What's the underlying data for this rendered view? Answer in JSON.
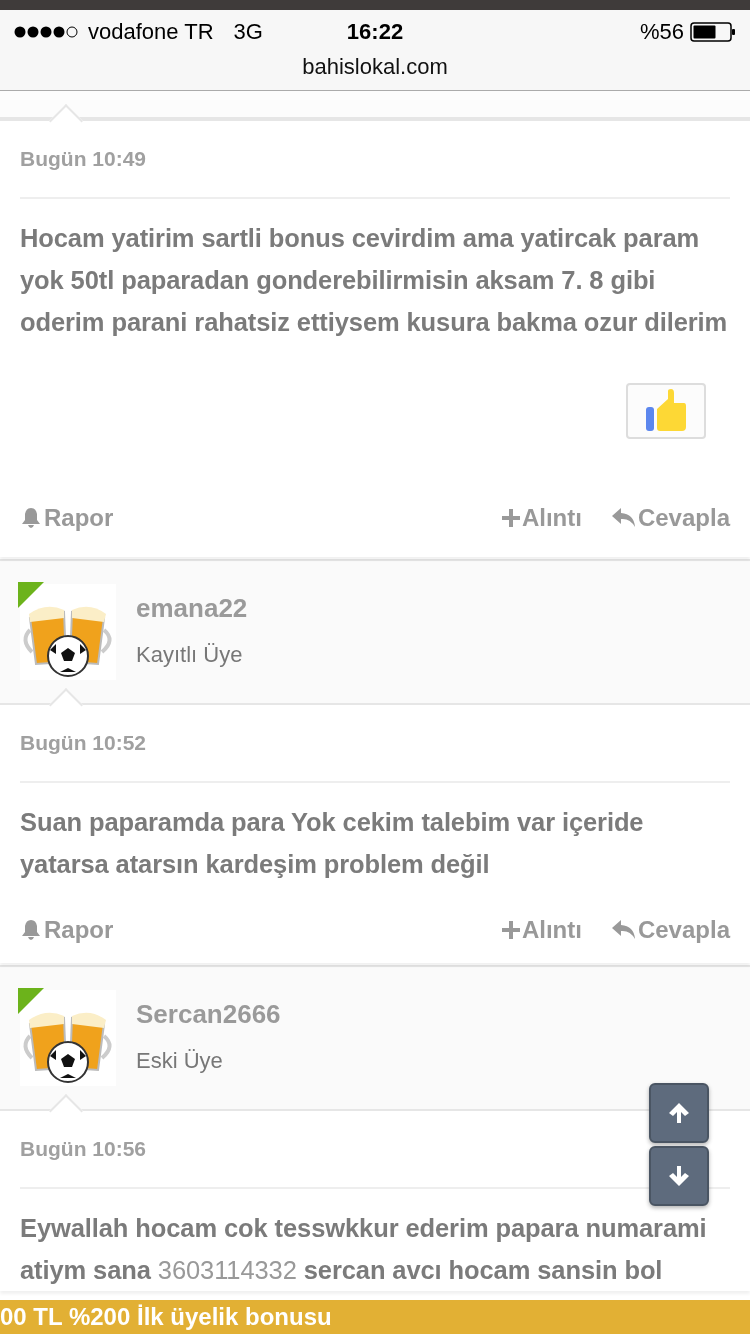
{
  "status_bar": {
    "carrier": "vodafone TR",
    "network": "3G",
    "time": "16:22",
    "battery": "%56"
  },
  "address_bar": {
    "url": "bahislokal.com"
  },
  "posts": [
    {
      "date": "Bugün 10:49",
      "message": [
        {
          "kind": "plain",
          "text": "Hocam yatirim sartli bonus cevirdim ama yatircak param yok 50tl paparadan gonderebilirmisin aksam 7. 8 gibi oderim parani rahatsiz ettiysem kusura bakma ozur dilerim"
        }
      ],
      "liked": true,
      "actions": {
        "report": "Rapor",
        "quote": "Alıntı",
        "reply": "Cevapla"
      }
    },
    {
      "user": {
        "name": "emana22",
        "role": "Kayıtlı Üye",
        "online": true
      },
      "date": "Bugün 10:52",
      "message": [
        {
          "kind": "plain",
          "text": "Suan paparamda para Yok cekim talebim var içeride yatarsa atarsın kardeşim problem değil"
        }
      ],
      "actions": {
        "report": "Rapor",
        "quote": "Alıntı",
        "reply": "Cevapla"
      }
    },
    {
      "user": {
        "name": "Sercan2666",
        "role": "Eski Üye",
        "online": true
      },
      "date": "Bugün 10:56",
      "message": [
        {
          "kind": "plain",
          "text": "Eywallah hocam cok tesswkkur ederim papara numarami atiym sana "
        },
        {
          "kind": "number",
          "text": "3603114332"
        },
        {
          "kind": "plain",
          "text": " sercan avcı hocam sansin bol"
        }
      ]
    }
  ],
  "banner": {
    "text": "00 TL %200 İlk üyelik bonusu"
  }
}
